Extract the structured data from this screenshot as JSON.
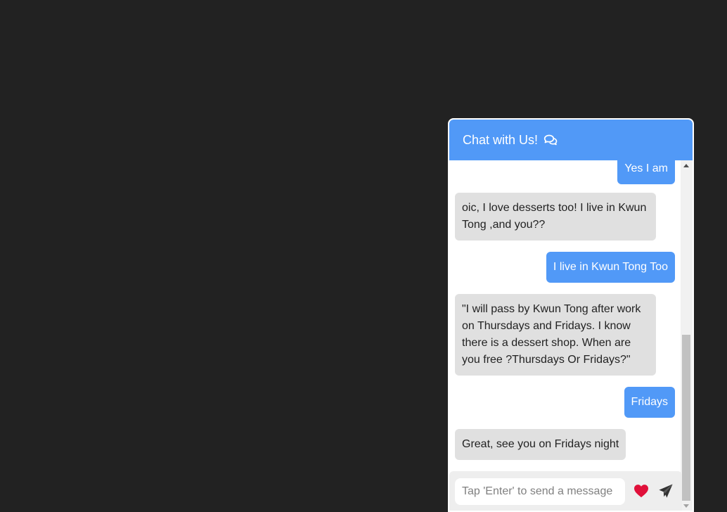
{
  "chat": {
    "title": "Chat with Us!",
    "header_icon": "comments-icon",
    "messages": [
      {
        "sender": "user",
        "text": "Yes I am"
      },
      {
        "sender": "bot",
        "text": "oic, I love desserts too! I live in Kwun Tong ,and you??"
      },
      {
        "sender": "user",
        "text": "I live in Kwun Tong Too"
      },
      {
        "sender": "bot",
        "text": "\"I will pass by Kwun Tong after work on Thursdays and Fridays. I know there is a dessert shop. When are you free ?Thursdays Or Fridays?\""
      },
      {
        "sender": "user",
        "text": "Fridays"
      },
      {
        "sender": "bot",
        "text": "Great, see you on Fridays night"
      }
    ],
    "input": {
      "placeholder": "Tap 'Enter' to send a message",
      "value": ""
    },
    "heart_icon": "heart-icon",
    "send_icon": "paper-plane-icon",
    "colors": {
      "page_background": "#222222",
      "header": "#5199f7",
      "user_bubble": "#5199f7",
      "bot_bubble": "#e0e0e0",
      "heart": "#e0103a",
      "send": "#333333"
    }
  }
}
